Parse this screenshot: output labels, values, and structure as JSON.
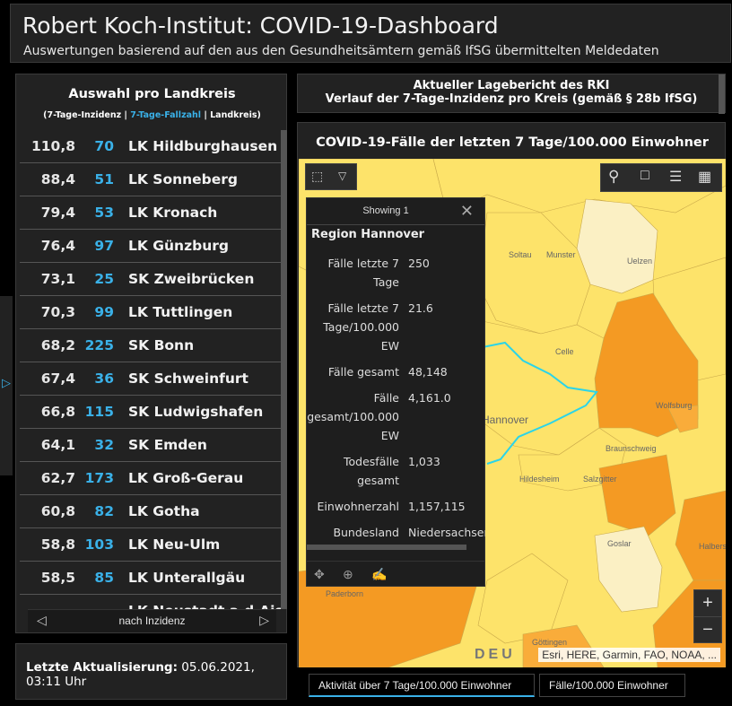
{
  "header": {
    "title": "Robert Koch-Institut: COVID-19-Dashboard",
    "subtitle": "Auswertungen basierend auf den aus den Gesundheitsämtern gemäß IfSG übermittelten Meldedaten"
  },
  "list_panel": {
    "title": "Auswahl pro Landkreis",
    "legend_part1": "(7-Tage-Inzidenz | ",
    "legend_part2": "7-Tage-Fallzahl",
    "legend_part3": " | Landkreis)",
    "rows": [
      {
        "inz": "110,8",
        "cnt": "70",
        "name": "LK Hildburghausen"
      },
      {
        "inz": "88,4",
        "cnt": "51",
        "name": "LK Sonneberg"
      },
      {
        "inz": "79,4",
        "cnt": "53",
        "name": "LK Kronach"
      },
      {
        "inz": "76,4",
        "cnt": "97",
        "name": "LK Günzburg"
      },
      {
        "inz": "73,1",
        "cnt": "25",
        "name": "SK Zweibrücken"
      },
      {
        "inz": "70,3",
        "cnt": "99",
        "name": "LK Tuttlingen"
      },
      {
        "inz": "68,2",
        "cnt": "225",
        "name": "SK Bonn"
      },
      {
        "inz": "67,4",
        "cnt": "36",
        "name": "SK Schweinfurt"
      },
      {
        "inz": "66,8",
        "cnt": "115",
        "name": "SK Ludwigshafen"
      },
      {
        "inz": "64,1",
        "cnt": "32",
        "name": "SK Emden"
      },
      {
        "inz": "62,7",
        "cnt": "173",
        "name": "LK Groß-Gerau"
      },
      {
        "inz": "60,8",
        "cnt": "82",
        "name": "LK Gotha"
      },
      {
        "inz": "58,8",
        "cnt": "103",
        "name": "LK Neu-Ulm"
      },
      {
        "inz": "58,5",
        "cnt": "85",
        "name": "LK Unterallgäu"
      },
      {
        "inz": "",
        "cnt": "",
        "name": "LK Neustadt a.d.Aisch"
      }
    ],
    "footer_label": "nach Inzidenz",
    "prev_icon": "chevron-left-icon",
    "next_icon": "chevron-right-icon"
  },
  "update": {
    "label": "Letzte Aktualisierung:",
    "value": "05.06.2021, 03:11 Uhr"
  },
  "report": {
    "line1": "Aktueller Lagebericht des RKI",
    "line2": "Verlauf der 7-Tage-Inzidenz pro Kreis (gemäß § 28b IfSG)"
  },
  "map_panel": {
    "title": "COVID-19-Fälle der letzten 7 Tage/100.000 Einwohner",
    "popup": {
      "header": "Showing 1",
      "name": "Region Hannover",
      "fields": [
        {
          "key": "Fälle letzte 7 Tage",
          "value": "250"
        },
        {
          "key": "Fälle letzte 7 Tage/100.000 EW",
          "value": "21.6"
        },
        {
          "key": "Fälle gesamt",
          "value": "48,148"
        },
        {
          "key": "Fälle gesamt/100.000 EW",
          "value": "4,161.0"
        },
        {
          "key": "Todesfälle gesamt",
          "value": "1,033"
        },
        {
          "key": "Einwohnerzahl",
          "value": "1,157,115"
        },
        {
          "key": "Bundesland",
          "value": "Niedersachsen"
        }
      ]
    },
    "places": [
      "Soltau",
      "Munster",
      "Uelzen",
      "Celle",
      "Hannover",
      "Wolfsburg",
      "Braunschweig",
      "Hildesheim",
      "Salzgitter",
      "Goslar",
      "Halberstadt",
      "Paderborn",
      "Göttingen"
    ],
    "attribution": "Esri, HERE, Garmin, FAO, NOAA, ...",
    "watermark": "DEU",
    "zoom_in": "+",
    "zoom_out": "−",
    "colors": {
      "light": "#fbf0c4",
      "yellow": "#fde36a",
      "orange": "#f9ac3a",
      "dark_orange": "#f49a23",
      "river": "#2bd4e8"
    }
  },
  "tabs": [
    {
      "label": "Aktivität über 7 Tage/100.000 Einwohner",
      "active": true
    },
    {
      "label": "Fälle/100.000 Einwohner",
      "active": false
    }
  ]
}
